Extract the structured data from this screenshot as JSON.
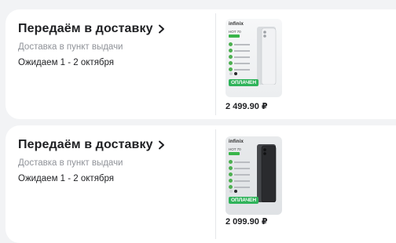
{
  "orders": [
    {
      "status_title": "Передаём в доставку",
      "delivery_type": "Доставка в пункт выдачи",
      "expected": "Ожидаем 1 - 2 октября",
      "product": {
        "brand": "infinix",
        "model": "HOT 70",
        "badge": "ОПЛАЧЕН",
        "phone_color": "#f1f2f4"
      },
      "price": "2 499.90 ₽"
    },
    {
      "status_title": "Передаём в доставку",
      "delivery_type": "Доставка в пункт выдачи",
      "expected": "Ожидаем 1 - 2 октября",
      "product": {
        "brand": "infinix",
        "model": "HOT 70",
        "badge": "ОПЛАЧЕН",
        "phone_color": "#2a2b2e"
      },
      "price": "2 099.90 ₽"
    }
  ],
  "colors": {
    "accent_green": "#2fb35a",
    "muted_text": "#8f9298",
    "background": "#f2f3f5"
  }
}
